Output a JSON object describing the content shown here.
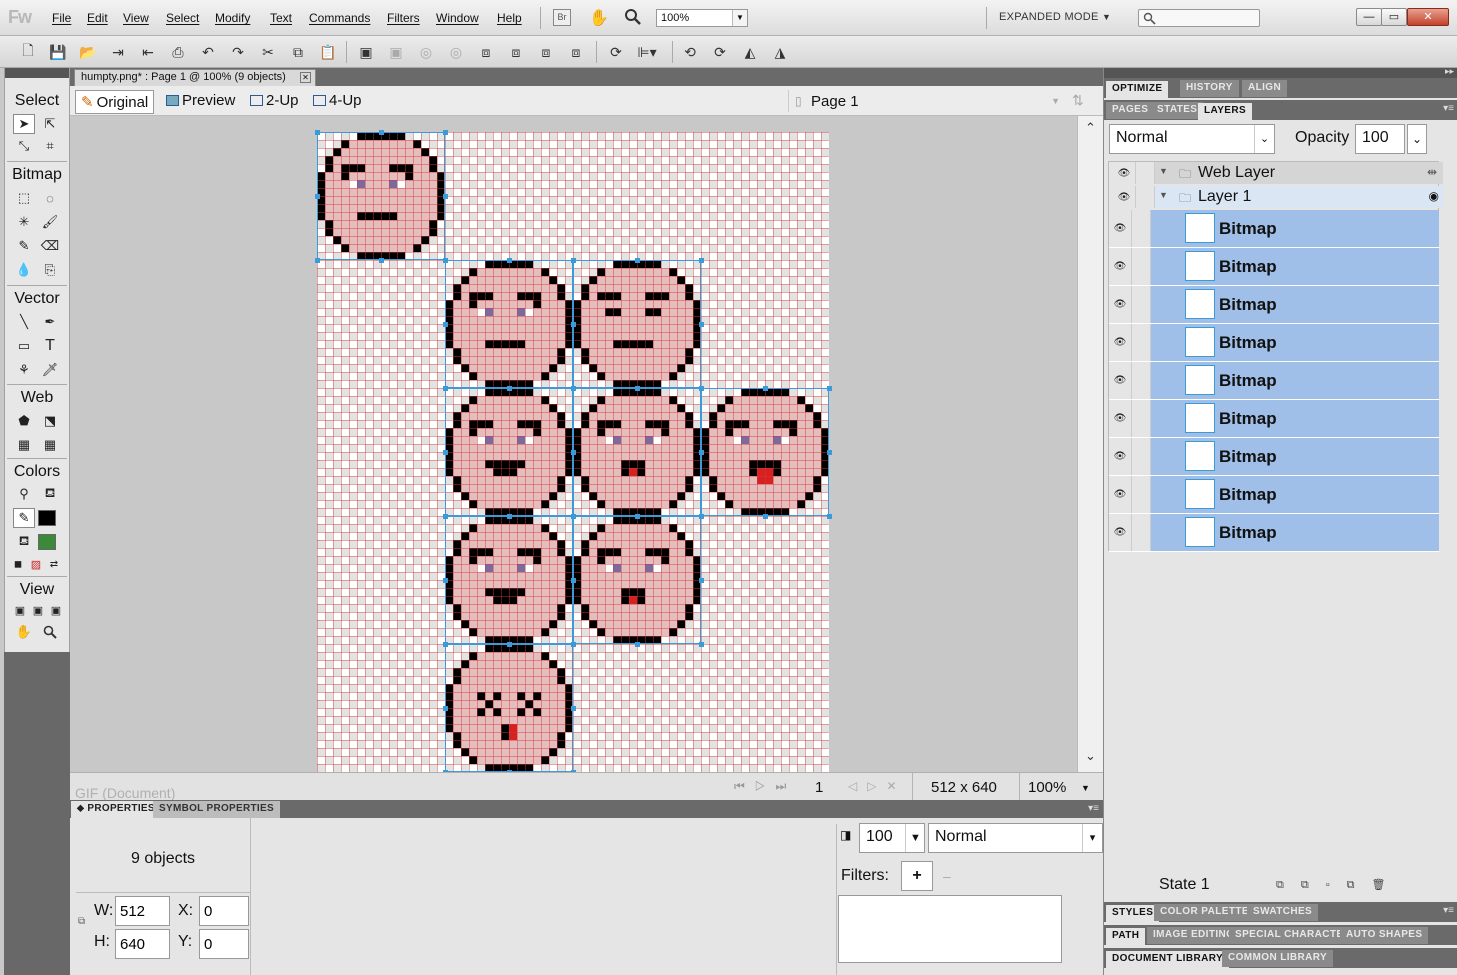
{
  "app": {
    "logo": "Fw",
    "mode_label": "EXPANDED MODE",
    "zoom": "100%"
  },
  "menu": [
    "File",
    "Edit",
    "View",
    "Select",
    "Modify",
    "Text",
    "Commands",
    "Filters",
    "Window",
    "Help"
  ],
  "window_controls": {
    "minimize": "—",
    "maximize": "▭",
    "close": "✕"
  },
  "document": {
    "tab_title": "humpty.png* : Page 1 @ 100% (9 objects)",
    "close": "✕"
  },
  "view_tabs": [
    "Original",
    "Preview",
    "2-Up",
    "4-Up"
  ],
  "page_selector": "Page 1",
  "tools": {
    "sections": [
      "Select",
      "Bitmap",
      "Vector",
      "Web",
      "Colors",
      "View"
    ],
    "select_tools": [
      "pointer",
      "subselect",
      "scale",
      "crop"
    ],
    "bitmap_tools": [
      "marquee",
      "lasso",
      "magic-wand",
      "brush",
      "pencil",
      "eraser",
      "blur",
      "rubber-stamp"
    ],
    "vector_tools": [
      "line",
      "pen",
      "rectangle",
      "text",
      "freeform",
      "knife"
    ],
    "web_tools": [
      "hotspot",
      "slice",
      "hide-slices",
      "show-slices"
    ],
    "colors": {
      "stroke": "#000000",
      "fill": "#3a8a3a"
    }
  },
  "status": {
    "format": "GIF (Document)",
    "frame": "1",
    "dimensions": "512 x 640",
    "zoom": "100%"
  },
  "properties": {
    "tabs": [
      "PROPERTIES",
      "SYMBOL PROPERTIES"
    ],
    "summary": "9 objects",
    "w_label": "W:",
    "w": "512",
    "h_label": "H:",
    "h": "640",
    "x_label": "X:",
    "x": "0",
    "y_label": "Y:",
    "y": "0",
    "opacity": "100",
    "blend": "Normal",
    "filters_label": "Filters:",
    "add_filter": "+"
  },
  "panels": {
    "top_tabs": [
      "OPTIMIZE",
      "HISTORY",
      "ALIGN"
    ],
    "layer_tabs": [
      "PAGES",
      "STATES",
      "LAYERS"
    ],
    "blend": "Normal",
    "opacity_label": "Opacity",
    "opacity": "100",
    "folders": [
      "Web Layer",
      "Layer 1"
    ],
    "layers": [
      "Bitmap",
      "Bitmap",
      "Bitmap",
      "Bitmap",
      "Bitmap",
      "Bitmap",
      "Bitmap",
      "Bitmap",
      "Bitmap"
    ],
    "state_label": "State 1",
    "bottom_tabs_1": [
      "STYLES",
      "COLOR PALETTE",
      "SWATCHES"
    ],
    "bottom_tabs_2": [
      "PATH",
      "IMAGE EDITING",
      "SPECIAL CHARACTERS",
      "AUTO SHAPES"
    ],
    "bottom_tabs_3": [
      "DOCUMENT LIBRARY",
      "COMMON LIBRARY"
    ]
  },
  "sprite_colors": {
    "face": "#e6bcbc",
    "outline": "#000000",
    "eye": "#7a6aa0",
    "tongue": "#d82020"
  }
}
